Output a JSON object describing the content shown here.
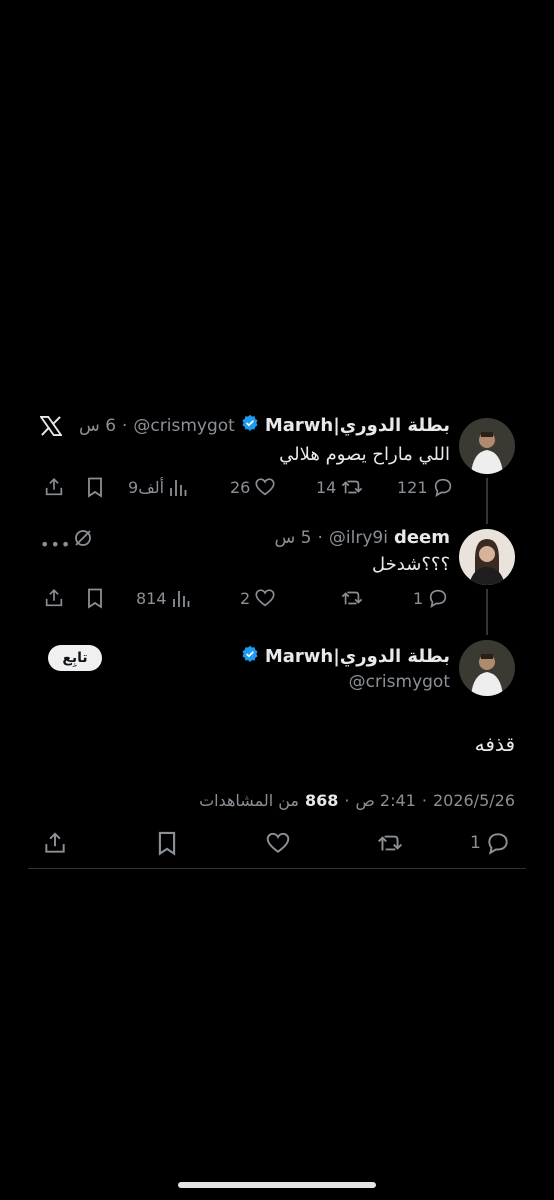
{
  "tweet1": {
    "name": "بطلة الدوري|Marwh",
    "handle": "@crismygot",
    "time": "6 س",
    "text": "اللي ماراح يصوم هلالي",
    "replies": "121",
    "retweets": "14",
    "likes": "26",
    "views": "9ألف"
  },
  "tweet2": {
    "name": "deem",
    "handle": "@ilry9i",
    "time": "5 س",
    "text": "؟؟؟شدخل",
    "replies": "1",
    "retweets": "",
    "likes": "2",
    "views": "814"
  },
  "main_tweet": {
    "name": "بطلة الدوري|Marwh",
    "handle": "@crismygot",
    "follow_label": "تابِع",
    "text": "قذفه",
    "date": "2026/5/26",
    "clock": "2:41 ص",
    "views_count": "868",
    "views_label": "من المشاهدات",
    "replies": "1"
  },
  "icons": [
    "x-logo-icon",
    "verified-badge-icon",
    "reply-icon",
    "retweet-icon",
    "like-icon",
    "views-icon",
    "bookmark-icon",
    "share-icon",
    "more-icon",
    "grok-icon"
  ],
  "colors": {
    "background": "#000000",
    "verified": "#1d9bf0",
    "muted": "#8b9096",
    "text": "#e7e9ea"
  }
}
